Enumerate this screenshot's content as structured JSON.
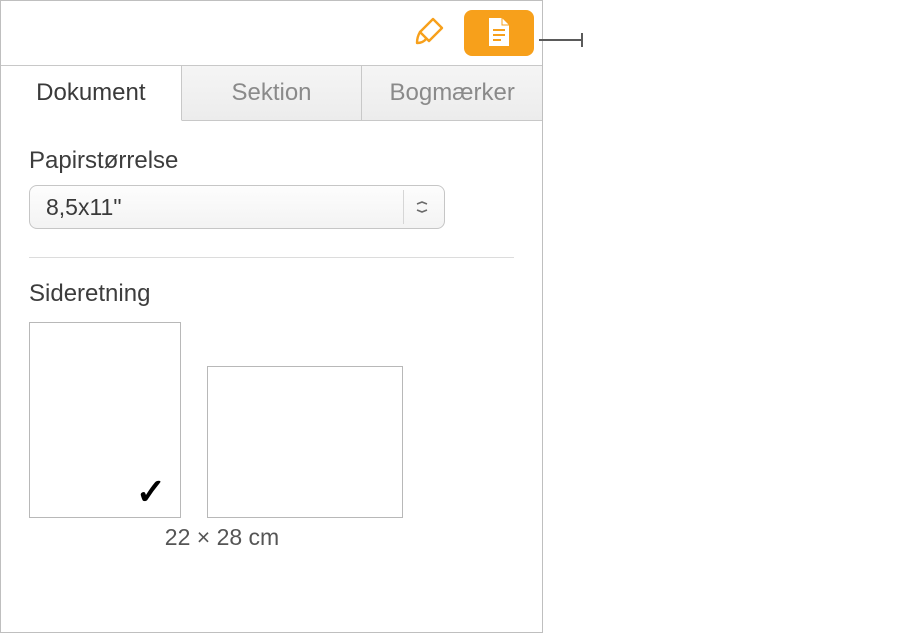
{
  "toolbar": {
    "format_icon": "paintbrush",
    "document_icon": "document"
  },
  "tabs": {
    "items": [
      {
        "label": "Dokument",
        "active": true
      },
      {
        "label": "Sektion",
        "active": false
      },
      {
        "label": "Bogmærker",
        "active": false
      }
    ]
  },
  "paper_size": {
    "label": "Papirstørrelse",
    "value": "8,5x11\""
  },
  "orientation": {
    "label": "Sideretning",
    "selected": "portrait",
    "dimensions": "22 × 28 cm"
  },
  "colors": {
    "accent": "#f7a01b"
  }
}
